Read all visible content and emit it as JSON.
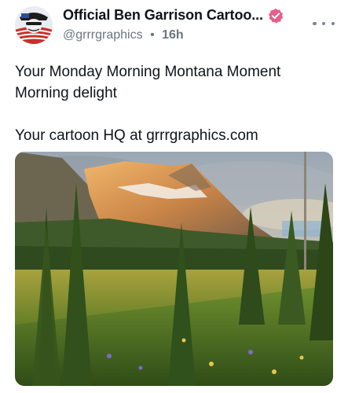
{
  "post": {
    "author": {
      "display_name": "Official  Ben Garrison Cartoo...",
      "handle": "@grrrgraphics",
      "separator": "•",
      "time": "16h",
      "verified_badge_color": "#e85d8a"
    },
    "text_lines": [
      "Your Monday Morning Montana Moment",
      "Morning delight",
      "",
      "Your cartoon HQ at grrrgraphics.com"
    ],
    "media": {
      "kind": "photo",
      "subject": "mountain landscape at sunrise"
    },
    "menu_icon": "more-horizontal-icon"
  }
}
